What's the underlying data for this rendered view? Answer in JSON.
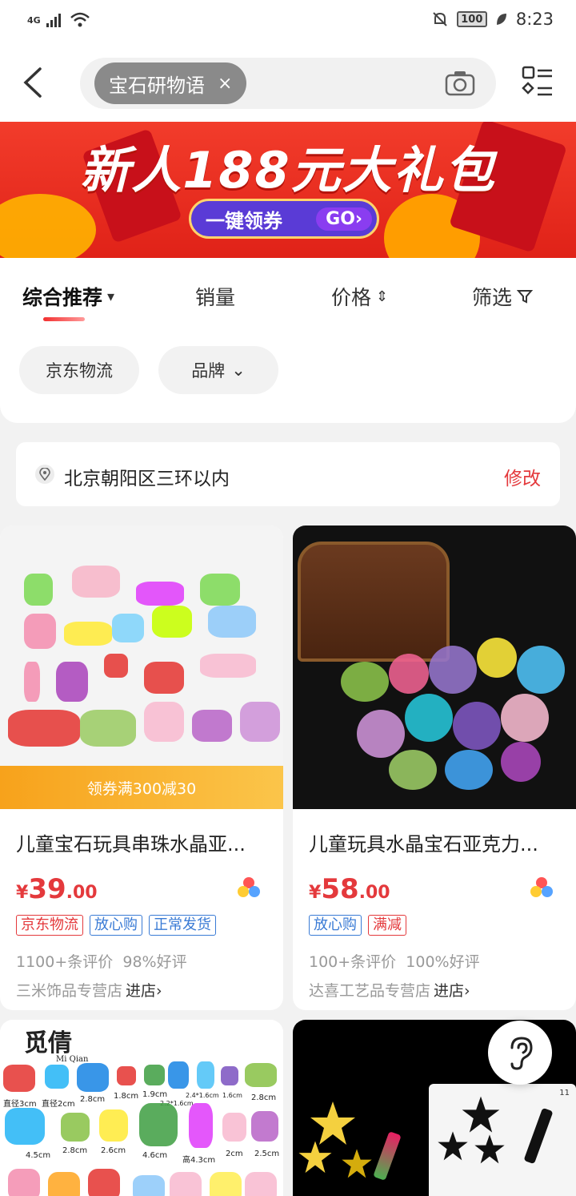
{
  "status_bar": {
    "network": "4G",
    "battery": "100",
    "time": "8:23"
  },
  "header": {
    "search_chip": "宝石研物语",
    "chip_clear": "×"
  },
  "banner": {
    "headline": "新人188元大礼包",
    "cta_text": "一键领券",
    "cta_go": "GO›"
  },
  "sort_tabs": [
    {
      "label": "综合推荐",
      "icon": "▾"
    },
    {
      "label": "销量",
      "icon": ""
    },
    {
      "label": "价格",
      "icon": "⇕"
    },
    {
      "label": "筛选",
      "icon": "filter-icon"
    }
  ],
  "filters": [
    {
      "label": "京东物流",
      "icon": ""
    },
    {
      "label": "品牌",
      "icon": "⌄"
    }
  ],
  "location": {
    "address": "北京朝阳区三环以内",
    "edit_label": "修改"
  },
  "products": [
    {
      "title": "儿童宝石玩具串珠水晶亚...",
      "price_symbol": "¥",
      "price_int": "39",
      "price_dec": ".00",
      "coupon": "领券满300减30",
      "tags": [
        {
          "text": "京东物流",
          "color": "red"
        },
        {
          "text": "放心购",
          "color": "blue"
        },
        {
          "text": "正常发货",
          "color": "blue"
        }
      ],
      "reviews": "1100+条评价",
      "rating": "98%好评",
      "shop": "三米饰品专营店",
      "enter": "进店›"
    },
    {
      "title": "儿童玩具水晶宝石亚克力...",
      "price_symbol": "¥",
      "price_int": "58",
      "price_dec": ".00",
      "tags": [
        {
          "text": "放心购",
          "color": "blue"
        },
        {
          "text": "满减",
          "color": "red"
        }
      ],
      "reviews": "100+条评价",
      "rating": "100%好评",
      "shop": "达喜工艺品专营店",
      "enter": "进店›"
    }
  ],
  "third_product": {
    "brand": "觅倩",
    "brand_en": "Mi Qian",
    "sizes": [
      "直径3cm",
      "直径2cm",
      "2.8cm",
      "1.8cm",
      "1.9cm",
      "2.4*1.6cm",
      "1.6cm",
      "2.8cm",
      "2.2*1.6cm",
      "4.5cm",
      "2.8cm",
      "2.6cm",
      "4.6cm",
      "高4.3cm",
      "2cm",
      "2.5cm"
    ]
  },
  "fourth_product": {
    "badge": "11"
  },
  "colors": {
    "accent": "#e4393c",
    "blue_tag": "#3a7bd5"
  }
}
